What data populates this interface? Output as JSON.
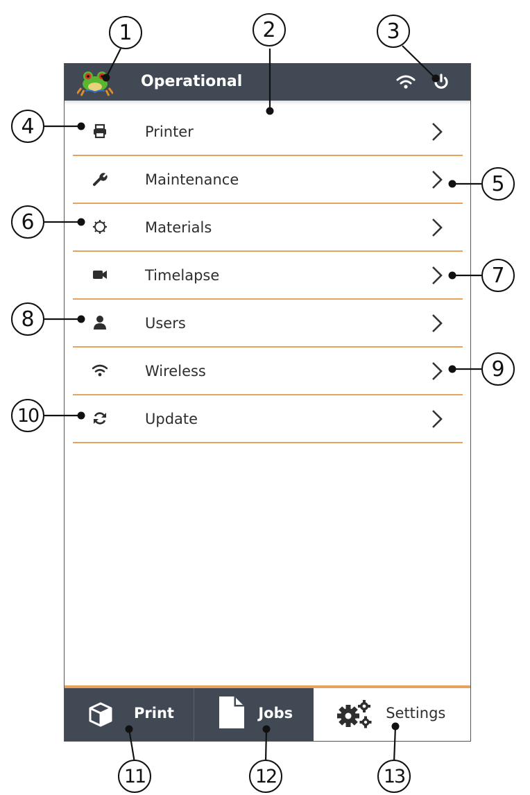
{
  "status_bar": {
    "title": "Operational"
  },
  "menu": {
    "items": [
      {
        "label": "Printer",
        "icon": "printer-icon"
      },
      {
        "label": "Maintenance",
        "icon": "wrench-icon"
      },
      {
        "label": "Materials",
        "icon": "gear-outline-icon"
      },
      {
        "label": "Timelapse",
        "icon": "video-camera-icon"
      },
      {
        "label": "Users",
        "icon": "user-icon"
      },
      {
        "label": "Wireless",
        "icon": "wifi-icon"
      },
      {
        "label": "Update",
        "icon": "refresh-icon"
      }
    ]
  },
  "tabs": [
    {
      "label": "Print",
      "icon": "cube-icon"
    },
    {
      "label": "Jobs",
      "icon": "document-icon"
    },
    {
      "label": "Settings",
      "icon": "gears-icon"
    }
  ],
  "callouts": [
    "1",
    "2",
    "3",
    "4",
    "5",
    "6",
    "7",
    "8",
    "9",
    "10",
    "11",
    "12",
    "13"
  ],
  "colors": {
    "bar": "#414a54",
    "accent": "#e7a35d",
    "background": "#ffffff"
  }
}
